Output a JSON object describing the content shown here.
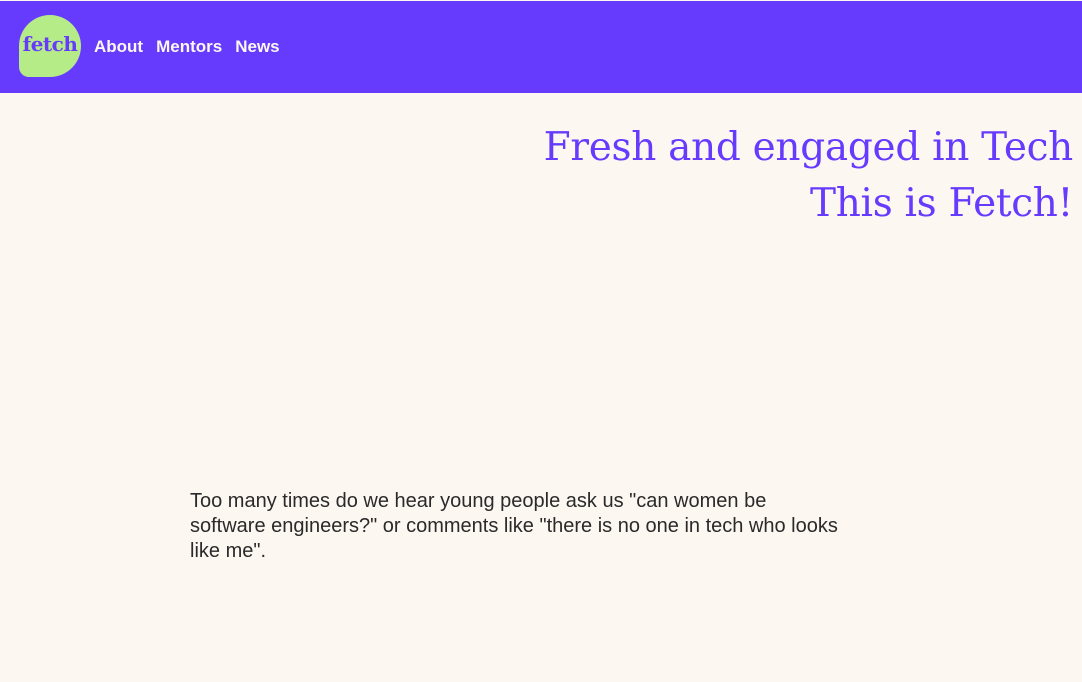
{
  "header": {
    "logo_text": "fetch",
    "nav": [
      {
        "label": "About"
      },
      {
        "label": "Mentors"
      },
      {
        "label": "News"
      }
    ]
  },
  "hero": {
    "line1": "Fresh and engaged in Tech",
    "line2": "This is Fetch!"
  },
  "intro": {
    "text": "Too many times do we hear young people ask us \"can women be software engineers?\" or comments like \"there is no one in tech who looks like me\"."
  },
  "colors": {
    "brand_purple": "#663bfe",
    "logo_green": "#b5ec88",
    "background": "#fdf7f1",
    "body_text": "#2a2a2a"
  }
}
